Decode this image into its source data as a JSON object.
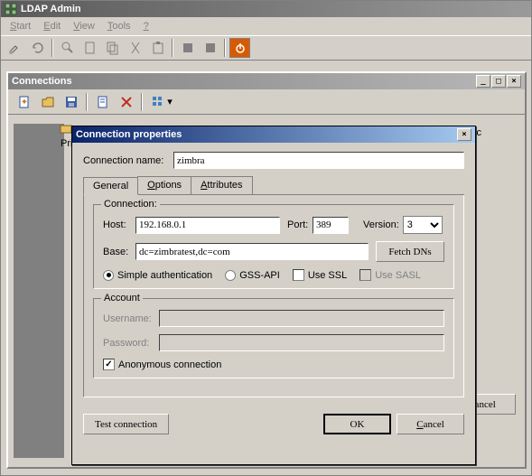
{
  "app": {
    "title": "LDAP Admin",
    "menu": [
      "Start",
      "Edit",
      "View",
      "Tools",
      "?"
    ]
  },
  "child": {
    "title": "Connections",
    "priv": "Pri",
    "right_char": "c",
    "cancel": "Cancel"
  },
  "dialog": {
    "title": "Connection properties",
    "conn_name_label": "Connection name:",
    "conn_name": "zimbra",
    "tabs": {
      "general": "General",
      "options": "Options",
      "attributes": "Attributes"
    },
    "connection": {
      "legend": "Connection:",
      "host_label": "Host:",
      "host": "192.168.0.1",
      "port_label": "Port:",
      "port": "389",
      "version_label": "Version:",
      "version": "3",
      "base_label": "Base:",
      "base": "dc=zimbratest,dc=com",
      "fetch": "Fetch DNs",
      "auth_simple": "Simple authentication",
      "auth_gss": "GSS-API",
      "use_ssl": "Use SSL",
      "use_sasl": "Use SASL"
    },
    "account": {
      "legend": "Account",
      "username_label": "Username:",
      "username": "",
      "password_label": "Password:",
      "password": "",
      "anon": "Anonymous connection"
    },
    "buttons": {
      "test": "Test connection",
      "ok": "OK",
      "cancel": "Cancel"
    }
  }
}
